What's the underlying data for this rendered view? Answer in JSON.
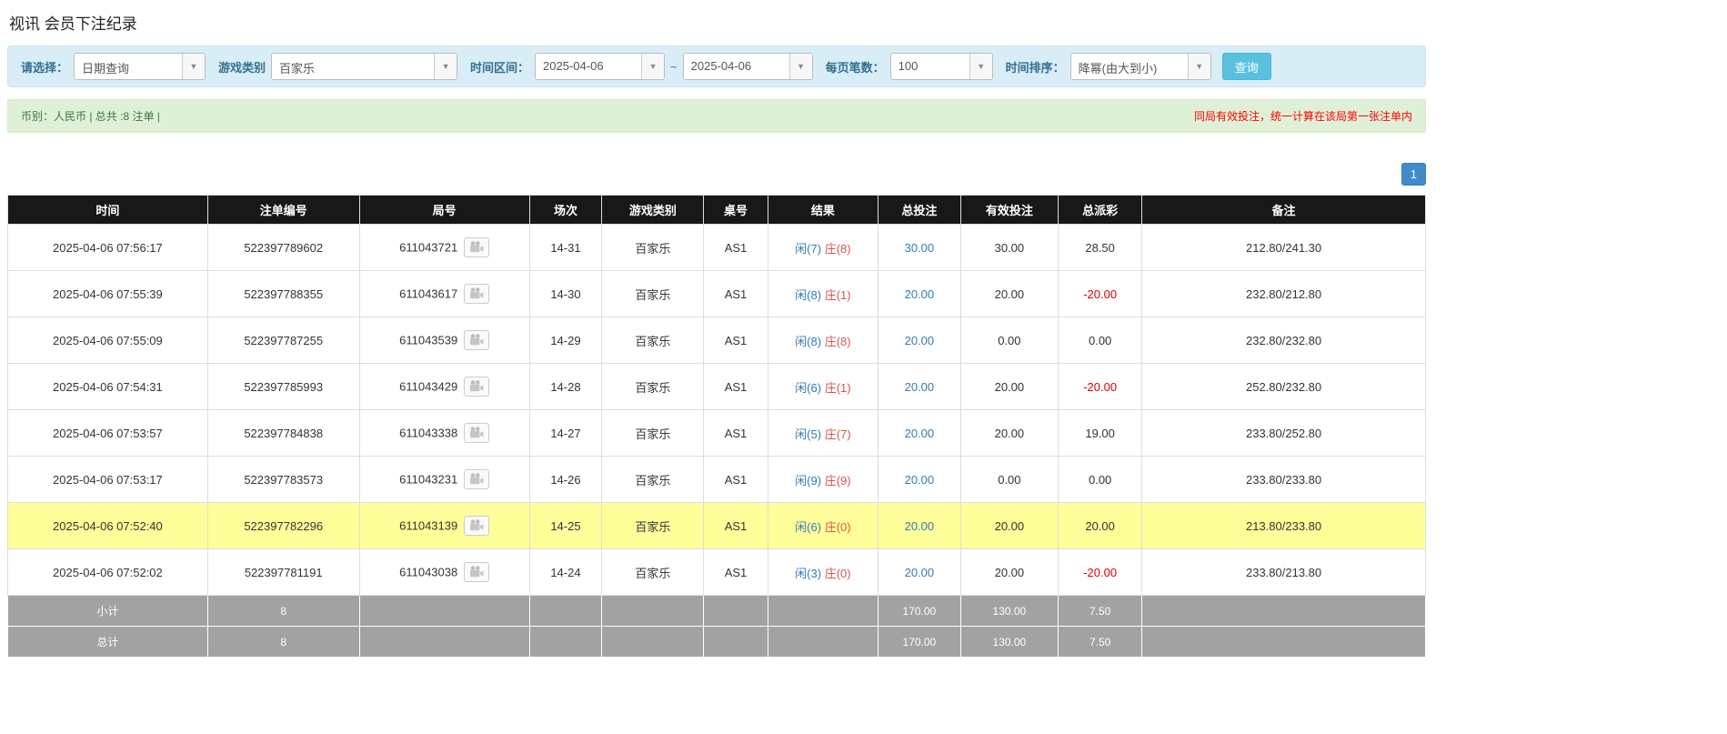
{
  "page": {
    "title": "视讯 会员下注纪录"
  },
  "filters": {
    "select_label": "请选择：",
    "select_value": "日期查询",
    "game_type_label": "游戏类别",
    "game_type_value": "百家乐",
    "time_range_label": "时间区间：",
    "time_from": "2025-04-06",
    "range_separator": "~",
    "time_to": "2025-04-06",
    "page_size_label": "每页笔数：",
    "page_size_value": "100",
    "sort_label": "时间排序：",
    "sort_value": "降幂(由大到小)",
    "search_button": "查询",
    "dropdown_caret": "▼"
  },
  "summary": {
    "left": "币别：人民币 | 总共 :8 注单 |",
    "right": "同局有效投注，统一计算在该局第一张注单内"
  },
  "pagination": {
    "pages": [
      "1"
    ]
  },
  "table": {
    "headers": [
      "时间",
      "注单编号",
      "局号",
      "场次",
      "游戏类别",
      "桌号",
      "结果",
      "总投注",
      "有效投注",
      "总派彩",
      "备注"
    ],
    "rows": [
      {
        "time": "2025-04-06 07:56:17",
        "bet_id": "522397789602",
        "round_id": "611043721",
        "session": "14-31",
        "game": "百家乐",
        "table_no": "AS1",
        "result_player": "闲(7)",
        "result_banker": "庄(8)",
        "total_bet": "30.00",
        "valid_bet": "30.00",
        "payout": "28.50",
        "note": "212.80/241.30",
        "highlight": false
      },
      {
        "time": "2025-04-06 07:55:39",
        "bet_id": "522397788355",
        "round_id": "611043617",
        "session": "14-30",
        "game": "百家乐",
        "table_no": "AS1",
        "result_player": "闲(8)",
        "result_banker": "庄(1)",
        "total_bet": "20.00",
        "valid_bet": "20.00",
        "payout": "-20.00",
        "note": "232.80/212.80",
        "highlight": false
      },
      {
        "time": "2025-04-06 07:55:09",
        "bet_id": "522397787255",
        "round_id": "611043539",
        "session": "14-29",
        "game": "百家乐",
        "table_no": "AS1",
        "result_player": "闲(8)",
        "result_banker": "庄(8)",
        "total_bet": "20.00",
        "valid_bet": "0.00",
        "payout": "0.00",
        "note": "232.80/232.80",
        "highlight": false
      },
      {
        "time": "2025-04-06 07:54:31",
        "bet_id": "522397785993",
        "round_id": "611043429",
        "session": "14-28",
        "game": "百家乐",
        "table_no": "AS1",
        "result_player": "闲(6)",
        "result_banker": "庄(1)",
        "total_bet": "20.00",
        "valid_bet": "20.00",
        "payout": "-20.00",
        "note": "252.80/232.80",
        "highlight": false
      },
      {
        "time": "2025-04-06 07:53:57",
        "bet_id": "522397784838",
        "round_id": "611043338",
        "session": "14-27",
        "game": "百家乐",
        "table_no": "AS1",
        "result_player": "闲(5)",
        "result_banker": "庄(7)",
        "total_bet": "20.00",
        "valid_bet": "20.00",
        "payout": "19.00",
        "note": "233.80/252.80",
        "highlight": false
      },
      {
        "time": "2025-04-06 07:53:17",
        "bet_id": "522397783573",
        "round_id": "611043231",
        "session": "14-26",
        "game": "百家乐",
        "table_no": "AS1",
        "result_player": "闲(9)",
        "result_banker": "庄(9)",
        "total_bet": "20.00",
        "valid_bet": "0.00",
        "payout": "0.00",
        "note": "233.80/233.80",
        "highlight": false
      },
      {
        "time": "2025-04-06 07:52:40",
        "bet_id": "522397782296",
        "round_id": "611043139",
        "session": "14-25",
        "game": "百家乐",
        "table_no": "AS1",
        "result_player": "闲(6)",
        "result_banker": "庄(0)",
        "total_bet": "20.00",
        "valid_bet": "20.00",
        "payout": "20.00",
        "note": "213.80/233.80",
        "highlight": true
      },
      {
        "time": "2025-04-06 07:52:02",
        "bet_id": "522397781191",
        "round_id": "611043038",
        "session": "14-24",
        "game": "百家乐",
        "table_no": "AS1",
        "result_player": "闲(3)",
        "result_banker": "庄(0)",
        "total_bet": "20.00",
        "valid_bet": "20.00",
        "payout": "-20.00",
        "note": "233.80/213.80",
        "highlight": false
      }
    ],
    "footer": [
      {
        "label": "小计",
        "count": "8",
        "total_bet": "170.00",
        "valid_bet": "130.00",
        "payout": "7.50"
      },
      {
        "label": "总计",
        "count": "8",
        "total_bet": "170.00",
        "valid_bet": "130.00",
        "payout": "7.50"
      }
    ]
  },
  "colors": {
    "filter_bar_bg": "#d9edf7",
    "filter_label": "#31708f",
    "summary_bg": "#dff0d8",
    "summary_text": "#3c763d",
    "notice_red": "#ff0000",
    "table_header_bg": "#181818",
    "highlight_row": "#ffff99",
    "link_blue": "#337ab7",
    "player_blue": "#337ab7",
    "banker_red": "#d9534f",
    "negative_red": "#dd0000",
    "footer_bg": "#a2a2a2",
    "pager_blue": "#428bca",
    "search_button_bg": "#5bc0de"
  }
}
